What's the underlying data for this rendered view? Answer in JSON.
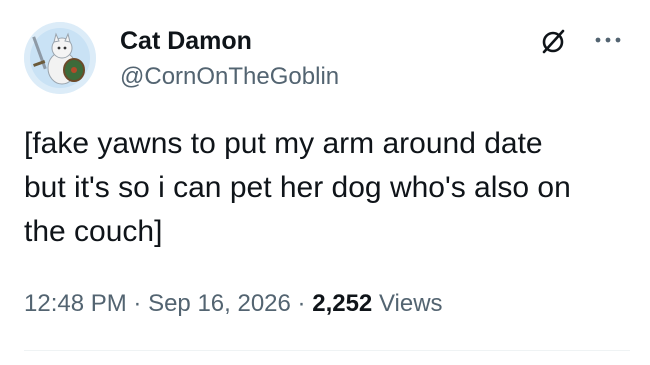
{
  "author": {
    "display_name": "Cat Damon",
    "handle": "@CornOnTheGoblin"
  },
  "tweet": {
    "lines": [
      "[fake yawns to put my arm around date",
      "but it's so i can pet her dog who's also on",
      "the couch]"
    ]
  },
  "meta": {
    "time": "12:48 PM",
    "separator": "·",
    "date": "Sep 16, 2026",
    "views_count": "2,252",
    "views_label": "Views"
  },
  "icons": {
    "grok": "grok-slash-circle-icon",
    "more": "more-horizontal-icon"
  },
  "colors": {
    "text_primary": "#0f1419",
    "text_secondary": "#536471",
    "divider": "#eff3f4"
  }
}
